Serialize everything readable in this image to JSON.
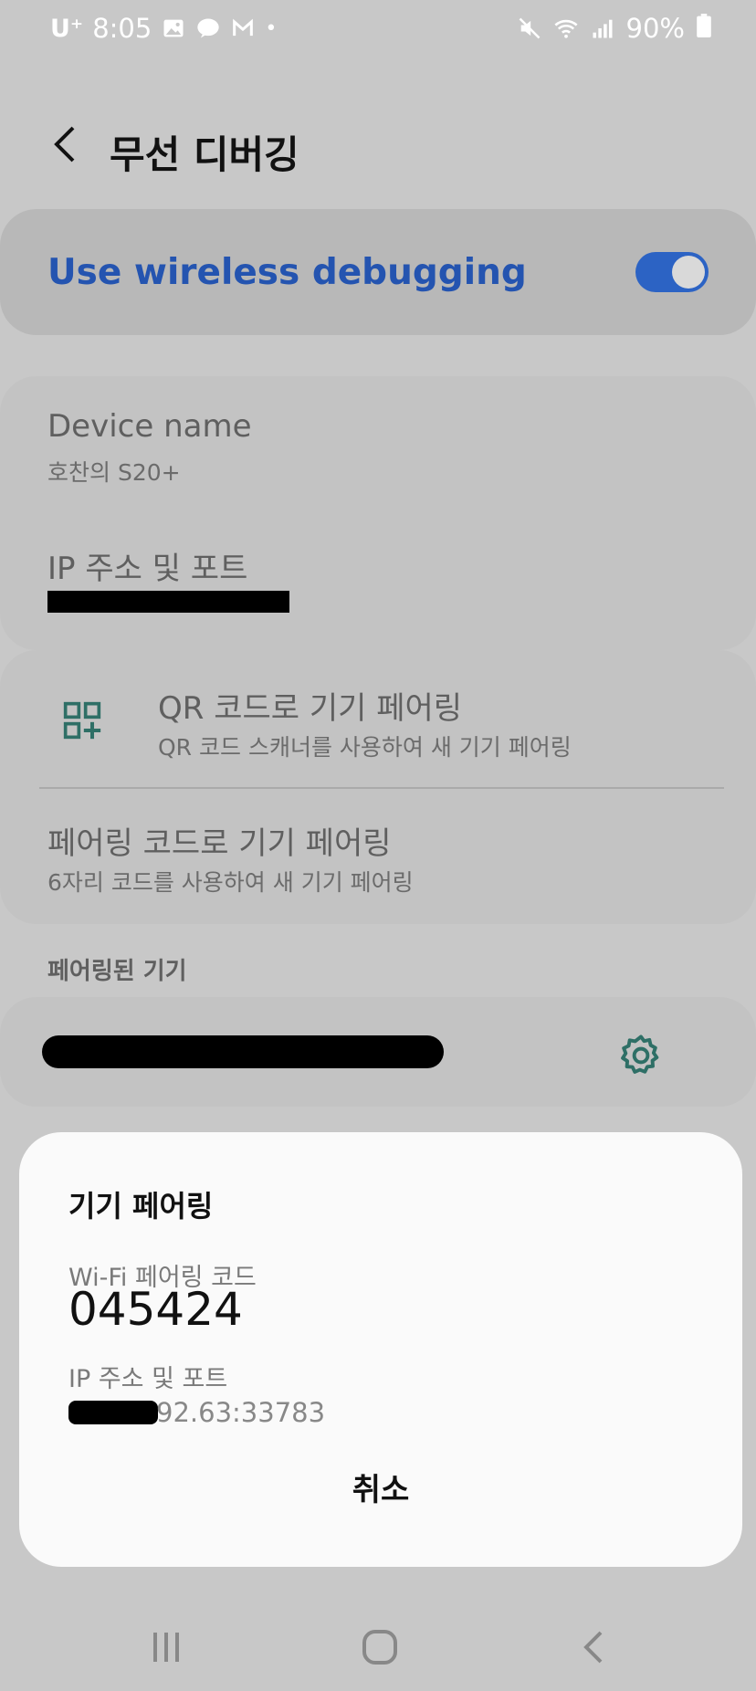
{
  "status_bar": {
    "carrier": "U⁺",
    "time": "8:05",
    "extra_dot": "•",
    "battery": "90%"
  },
  "header": {
    "title": "무선 디버깅"
  },
  "master_switch": {
    "label": "Use wireless debugging",
    "enabled": true
  },
  "device": {
    "name_title": "Device name",
    "name_value": "호찬의 S20+",
    "ip_title": "IP 주소 및 포트"
  },
  "pairing": {
    "qr_title": "QR 코드로 기기 페어링",
    "qr_sub": "QR 코드 스캐너를 사용하여 새 기기 페어링",
    "code_title": "페어링 코드로 기기 페어링",
    "code_sub": "6자리 코드를 사용하여 새 기기 페어링"
  },
  "paired": {
    "section_title": "페어링된 기기"
  },
  "dialog": {
    "title": "기기 페어링",
    "wifi_label": "Wi-Fi 페어링 코드",
    "code": "045424",
    "ip_label": "IP 주소 및 포트",
    "ip_visible": "92.63:33783",
    "cancel": "취소"
  },
  "colors": {
    "accent": "#2454b0",
    "toggle": "#2c63c4",
    "icon_teal": "#2e6f66"
  },
  "icons": [
    "image-icon",
    "talk-icon",
    "gmail-icon",
    "mute-icon",
    "wifi-icon",
    "signal-icon",
    "battery-icon",
    "back-icon",
    "qr-code-icon",
    "gear-icon",
    "recents-icon",
    "home-icon",
    "nav-back-icon"
  ]
}
